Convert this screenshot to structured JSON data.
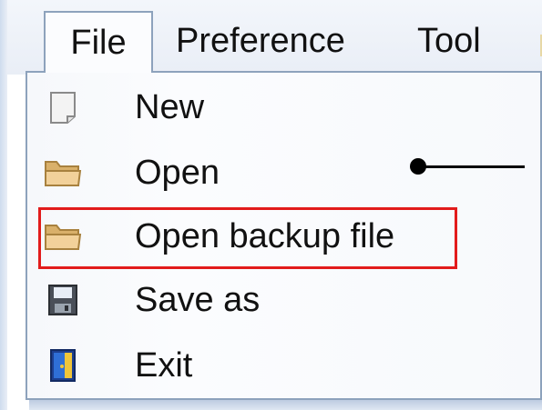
{
  "menubar": {
    "tabs": [
      {
        "label": "File"
      },
      {
        "label": "Preference"
      },
      {
        "label": "Tool"
      }
    ]
  },
  "file_menu": {
    "items": [
      {
        "label": "New",
        "icon": "new-document-icon"
      },
      {
        "label": "Open",
        "icon": "folder-icon"
      },
      {
        "label": "Open backup file",
        "icon": "folder-icon",
        "highlighted": true
      },
      {
        "label": "Save as",
        "icon": "floppy-disk-icon"
      },
      {
        "label": "Exit",
        "icon": "exit-door-icon"
      }
    ]
  },
  "annotation": {
    "highlight_color": "#e21b1b"
  }
}
